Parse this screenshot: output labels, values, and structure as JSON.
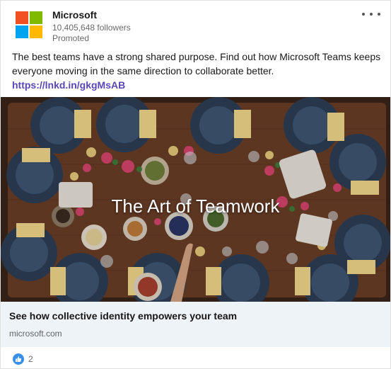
{
  "post": {
    "company": "Microsoft",
    "followers": "10,405,648 followers",
    "promoted": "Promoted",
    "text": "The best teams have a strong shared purpose. Find out how Microsoft Teams keeps everyone moving in the same direction to collaborate better.",
    "link": "https://lnkd.in/gkgMsAB"
  },
  "hero": {
    "title": "The Art of Teamwork"
  },
  "preview": {
    "title": "See how collective identity empowers your team",
    "domain": "microsoft.com"
  },
  "social": {
    "reaction_count": "2"
  },
  "colors": {
    "logo_red": "#f25022",
    "logo_green": "#7fba00",
    "logo_blue": "#00a4ef",
    "logo_yellow": "#ffb900",
    "link": "#5a46b4",
    "like": "#378fe9"
  },
  "icons": [
    "microsoft-logo-icon",
    "more-options-icon",
    "like-reaction-icon"
  ]
}
